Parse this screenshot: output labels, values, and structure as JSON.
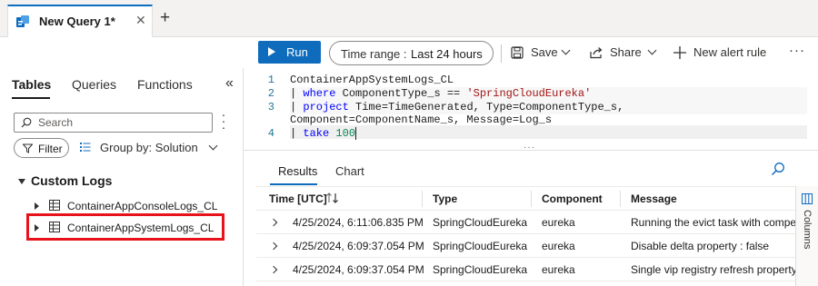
{
  "tabs": {
    "active_title": "New Query 1*",
    "close_glyph": "✕",
    "new_tab_glyph": "+"
  },
  "toolbar": {
    "run_label": "Run",
    "time_range_label": "Time range :",
    "time_range_value": "Last 24 hours",
    "save_label": "Save",
    "share_label": "Share",
    "new_alert_label": "New alert rule",
    "more_glyph": "···"
  },
  "left_panel": {
    "tabs": [
      "Tables",
      "Queries",
      "Functions"
    ],
    "collapse_glyph": "«",
    "search_placeholder": "Search",
    "filter_label": "Filter",
    "group_by_label": "Group by: Solution",
    "section_title": "Custom Logs",
    "tables": [
      "ContainerAppConsoleLogs_CL",
      "ContainerAppSystemLogs_CL"
    ]
  },
  "editor": {
    "line_numbers": [
      "1",
      "2",
      "3",
      "4"
    ],
    "line1": "ContainerAppSystemLogs_CL",
    "line2_pipe": "| ",
    "line2_kw": "where",
    "line2_mid": " ComponentType_s == ",
    "line2_str": "'SpringCloudEureka'",
    "line3_pipe": "| ",
    "line3_kw": "project",
    "line3_rest": " Time=TimeGenerated, Type=ComponentType_s,",
    "line3_wrap": "Component=ComponentName_s, Message=Log_s",
    "line4_pipe": "| ",
    "line4_kw": "take",
    "line4_space": " ",
    "line4_num": "100",
    "split_glyph": "···"
  },
  "results": {
    "tabs": [
      "Results",
      "Chart"
    ],
    "columns": [
      "Time [UTC]",
      "Type",
      "Component",
      "Message"
    ],
    "rows": [
      {
        "time": "4/25/2024, 6:11:06.835 PM",
        "type": "SpringCloudEureka",
        "component": "eureka",
        "message": "Running the evict task with compensa"
      },
      {
        "time": "4/25/2024, 6:09:37.054 PM",
        "type": "SpringCloudEureka",
        "component": "eureka",
        "message": "Disable delta property : false"
      },
      {
        "time": "4/25/2024, 6:09:37.054 PM",
        "type": "SpringCloudEureka",
        "component": "eureka",
        "message": "Single vip registry refresh property : n"
      }
    ],
    "columns_rail_label": "Columns"
  },
  "colors": {
    "accent": "#0f6cbd",
    "highlight_border": "#e8131a",
    "keyword": "#0000ff",
    "string": "#a31515",
    "number": "#098658",
    "line_number": "#237893"
  }
}
